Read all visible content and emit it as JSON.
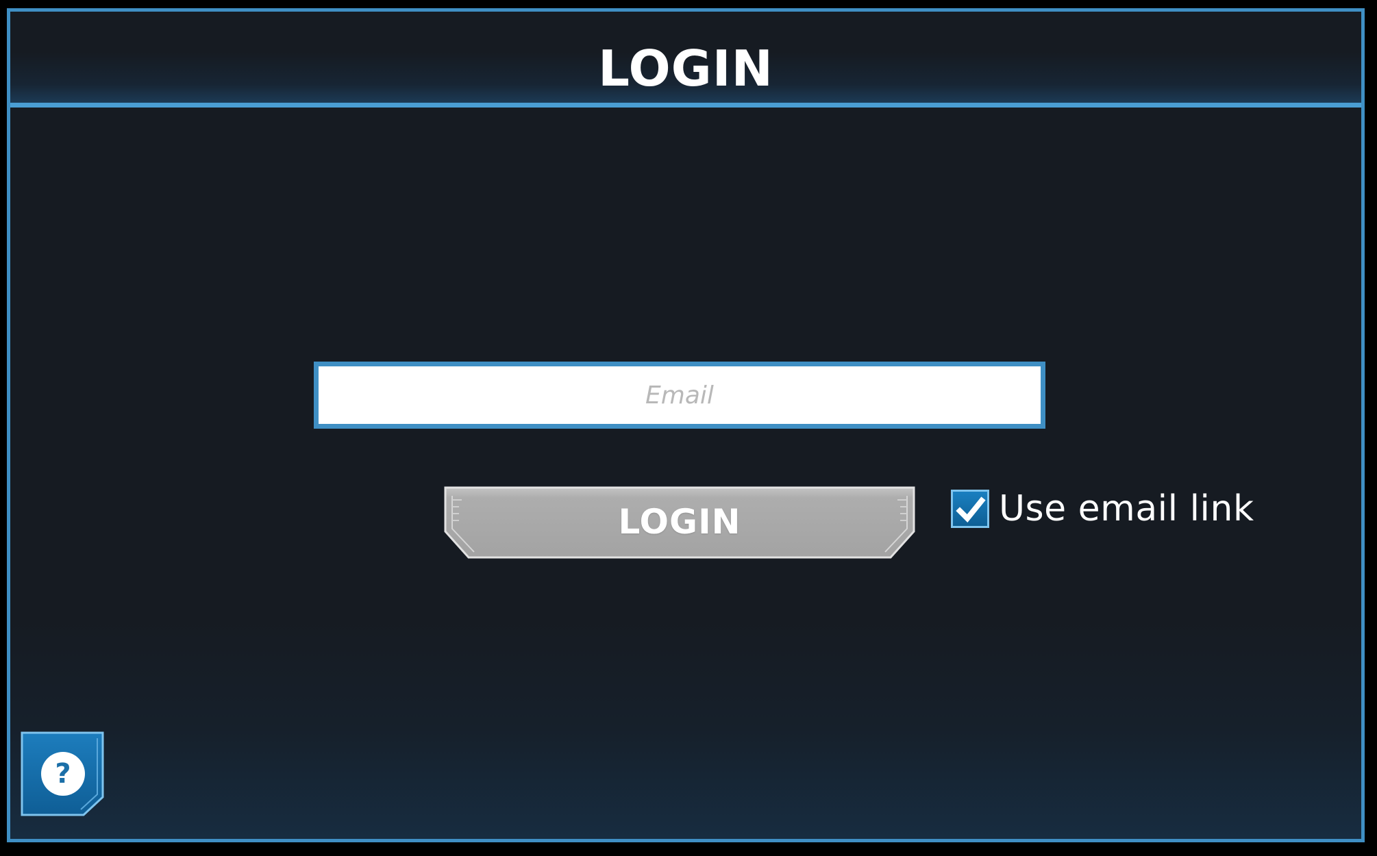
{
  "header": {
    "title": "LOGIN"
  },
  "form": {
    "email": {
      "value": "",
      "placeholder": "Email"
    },
    "login_label": "LOGIN",
    "use_email_link": {
      "label": "Use email link",
      "checked": true
    }
  },
  "help": {
    "label": "?"
  },
  "icons": {
    "checkbox": "checkmark-icon",
    "help": "question-mark-icon"
  },
  "colors": {
    "background": "#161b22",
    "accent_blue": "#3f8fc4",
    "button_gray": "#a9a9a9",
    "text_white": "#ffffff",
    "placeholder_gray": "#b8b8b8"
  }
}
